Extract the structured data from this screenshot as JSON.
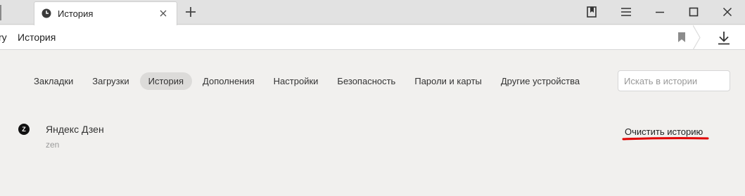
{
  "tabbar": {
    "active_tab_title": "История",
    "favicon_icon": "clock-icon",
    "close_icon": "close-icon",
    "new_tab_icon": "plus-icon"
  },
  "window_controls": {
    "collections_icon": "collections-icon",
    "menu_icon": "hamburger-menu-icon",
    "minimize_icon": "minimize-icon",
    "maximize_icon": "maximize-icon",
    "close_icon": "window-close-icon"
  },
  "addressbar": {
    "host_fragment": "ry",
    "page_title": "История",
    "bookmark_icon": "bookmark-icon",
    "downloads_icon": "download-icon"
  },
  "nav": {
    "items": [
      {
        "label": "Закладки"
      },
      {
        "label": "Загрузки"
      },
      {
        "label": "История",
        "active": true
      },
      {
        "label": "Дополнения"
      },
      {
        "label": "Настройки"
      },
      {
        "label": "Безопасность"
      },
      {
        "label": "Пароли и карты"
      },
      {
        "label": "Другие устройства"
      }
    ]
  },
  "search": {
    "placeholder": "Искать в истории",
    "value": ""
  },
  "history": {
    "entries": [
      {
        "title": "Яндекс Дзен",
        "url": "zen",
        "favicon_letter": "Z"
      }
    ],
    "clear_label": "Очистить историю"
  },
  "colors": {
    "annotation_underline": "#e00000",
    "active_nav_bg": "#dcdbd9",
    "page_bg": "#f1f0ee"
  }
}
